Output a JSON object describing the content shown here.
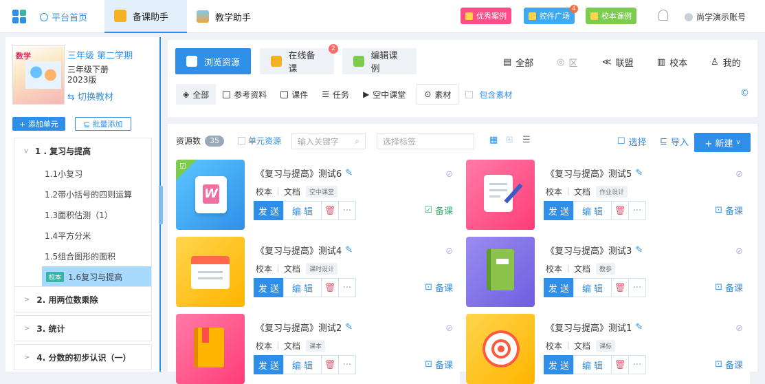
{
  "header": {
    "home_label": "平台首页",
    "tabs": [
      {
        "label": "备课助手",
        "active": true
      },
      {
        "label": "教学助手",
        "active": false
      }
    ],
    "quick": [
      {
        "label": "优秀案例",
        "color": "#ff4d88"
      },
      {
        "label": "控件广场",
        "color": "#3ea8f0",
        "badge": "4"
      },
      {
        "label": "校本课例",
        "color": "#7ccd4e"
      }
    ],
    "account": "尚学演示账号"
  },
  "textbook": {
    "cover_title": "数学",
    "grade": "三年级 第二学期",
    "volume": "三年级下册",
    "edition": "2023版",
    "switch_label": "切换教材"
  },
  "sidebar_buttons": {
    "add_unit": "+ 添加单元",
    "batch_add": "批量添加"
  },
  "units": [
    {
      "title": "1 . 复习与提高",
      "expanded": true,
      "lessons": [
        "1.1小复习",
        "1.2带小括号的四则运算",
        "1.3面积估测（1）",
        "1.4平方分米",
        "1.5组合图形的面积",
        "1.6复习与提高"
      ],
      "selected_tag": "校本"
    },
    {
      "title": "2. 用两位数乘除"
    },
    {
      "title": "3. 统计"
    },
    {
      "title": "4. 分数的初步认识（一）"
    }
  ],
  "modes": [
    {
      "label": "浏览资源",
      "active": true
    },
    {
      "label": "在线备课",
      "badge": "2"
    },
    {
      "label": "编辑课例"
    }
  ],
  "scope": [
    {
      "label": "全部",
      "icon": "calendar-icon"
    },
    {
      "label": "区",
      "icon": "target-icon"
    },
    {
      "label": "联盟",
      "icon": "share-icon"
    },
    {
      "label": "校本",
      "icon": "school-icon"
    },
    {
      "label": "我的",
      "icon": "user-icon"
    }
  ],
  "filters": [
    "全部",
    "参考资料",
    "课件",
    "任务",
    "空中课堂"
  ],
  "material": "素材",
  "include_material": "包含素材",
  "resources": {
    "count_label": "资源数",
    "count": "35",
    "unit_resource": "单元资源",
    "search_placeholder": "输入关键字",
    "tag_placeholder": "选择标签",
    "select_label": "选择",
    "import_label": "导入",
    "new_label": "+ 新建"
  },
  "cards": [
    {
      "title": "《复习与提高》测试6",
      "source": "校本",
      "type": "文档",
      "tag": "空中课堂",
      "prep": "备课",
      "prep_style": "green"
    },
    {
      "title": "《复习与提高》测试5",
      "source": "校本",
      "type": "文档",
      "tag": "作业设计",
      "prep": "备课",
      "prep_style": "blue"
    },
    {
      "title": "《复习与提高》测试4",
      "source": "校本",
      "type": "文档",
      "tag": "课时设计",
      "prep": "备课",
      "prep_style": "blue"
    },
    {
      "title": "《复习与提高》测试3",
      "source": "校本",
      "type": "文档",
      "tag": "教参",
      "prep": "备课",
      "prep_style": "blue"
    },
    {
      "title": "《复习与提高》测试2",
      "source": "校本",
      "type": "文档",
      "tag": "课本",
      "prep": "备课",
      "prep_style": "blue"
    },
    {
      "title": "《复习与提高》测试1",
      "source": "校本",
      "type": "文档",
      "tag": "课标",
      "prep": "备课",
      "prep_style": "blue"
    }
  ],
  "card_ops": {
    "send": "发 送",
    "edit": "编 辑",
    "delete": "🗑",
    "more": "···"
  },
  "thumb_icons": [
    "word-document-icon",
    "notepad-icon",
    "calendar-icon",
    "book-icon",
    "bookmark-book-icon",
    "target-icon"
  ]
}
